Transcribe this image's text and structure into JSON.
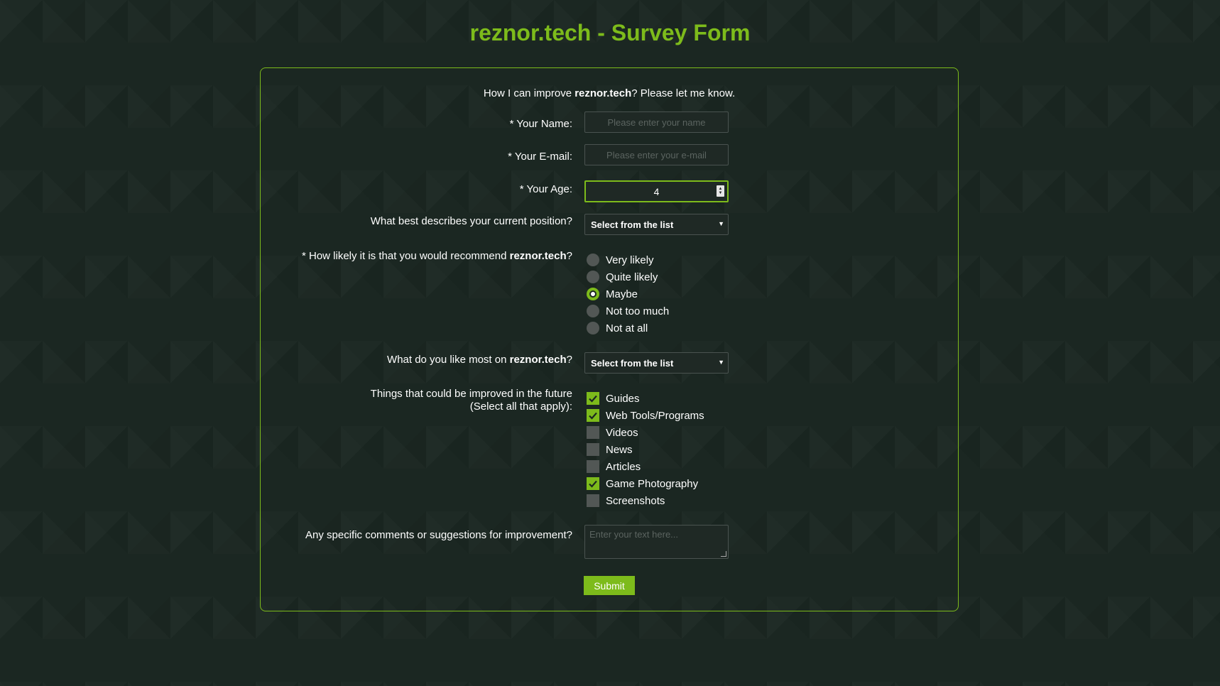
{
  "page": {
    "title": "reznor.tech - Survey Form"
  },
  "form": {
    "intro_prefix": "How I can improve ",
    "intro_brand": "reznor.tech",
    "intro_suffix": "? Please let me know.",
    "name": {
      "label": "* Your Name:",
      "placeholder": "Please enter your name",
      "value": ""
    },
    "email": {
      "label": "* Your E-mail:",
      "placeholder": "Please enter your e-mail",
      "value": ""
    },
    "age": {
      "label": "* Your Age:",
      "value": "4"
    },
    "position": {
      "label": "What best describes your current position?",
      "selected": "Select from the list"
    },
    "recommend": {
      "label_prefix": "* How likely it is that you would recommend ",
      "label_brand": "reznor.tech",
      "label_suffix": "?",
      "options": [
        {
          "label": "Very likely",
          "checked": false
        },
        {
          "label": "Quite likely",
          "checked": false
        },
        {
          "label": "Maybe",
          "checked": true
        },
        {
          "label": "Not too much",
          "checked": false
        },
        {
          "label": "Not at all",
          "checked": false
        }
      ]
    },
    "like_most": {
      "label_prefix": "What do you like most on ",
      "label_brand": "reznor.tech",
      "label_suffix": "?",
      "selected": "Select from the list"
    },
    "improve": {
      "label_line1": "Things that could be improved in the future",
      "label_line2": "(Select all that apply):",
      "options": [
        {
          "label": "Guides",
          "checked": true
        },
        {
          "label": "Web Tools/Programs",
          "checked": true
        },
        {
          "label": "Videos",
          "checked": false
        },
        {
          "label": "News",
          "checked": false
        },
        {
          "label": "Articles",
          "checked": false
        },
        {
          "label": "Game Photography",
          "checked": true
        },
        {
          "label": "Screenshots",
          "checked": false
        }
      ]
    },
    "comments": {
      "label": "Any specific comments or suggestions for improvement?",
      "placeholder": "Enter your text here..."
    },
    "submit_label": "Submit"
  },
  "colors": {
    "accent": "#7dbb1b",
    "background": "#1b2722",
    "control_unchecked": "#525755"
  }
}
